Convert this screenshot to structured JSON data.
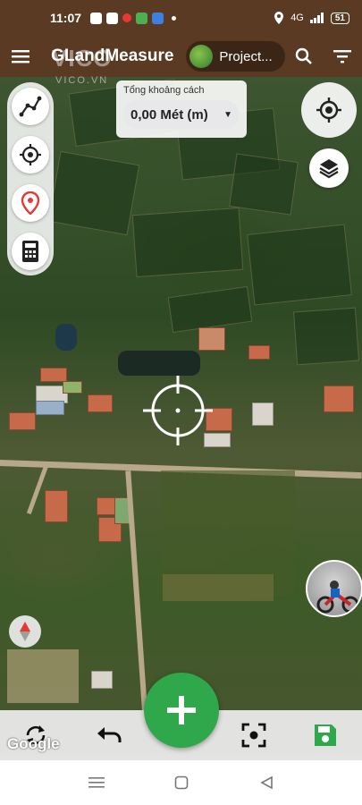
{
  "status_bar": {
    "time": "11:07",
    "network": "4G",
    "battery": "51"
  },
  "app_bar": {
    "title": "GLandMeasure",
    "project_label": "Project..."
  },
  "distance": {
    "label": "Tổng khoảng cách",
    "value": "0,00 Mét (m)"
  },
  "map": {
    "provider": "Google"
  },
  "watermark": {
    "text": "VICO",
    "sub": "VICO.VN"
  },
  "icons": {
    "menu": "menu-icon",
    "search": "search-icon",
    "filter": "filter-icon",
    "polyline": "polyline-icon",
    "target": "target-icon",
    "pin": "location-pin-icon",
    "calculator": "calculator-icon",
    "locate": "my-location-icon",
    "layers": "layers-icon",
    "compass": "compass-icon",
    "sync": "sync-icon",
    "undo": "undo-icon",
    "add": "add-icon",
    "focus": "center-focus-icon",
    "save": "save-icon"
  },
  "colors": {
    "app_bar": "#5a3a22",
    "fab": "#2ea84a",
    "save": "#2ea84a",
    "pin": "#e53935"
  }
}
